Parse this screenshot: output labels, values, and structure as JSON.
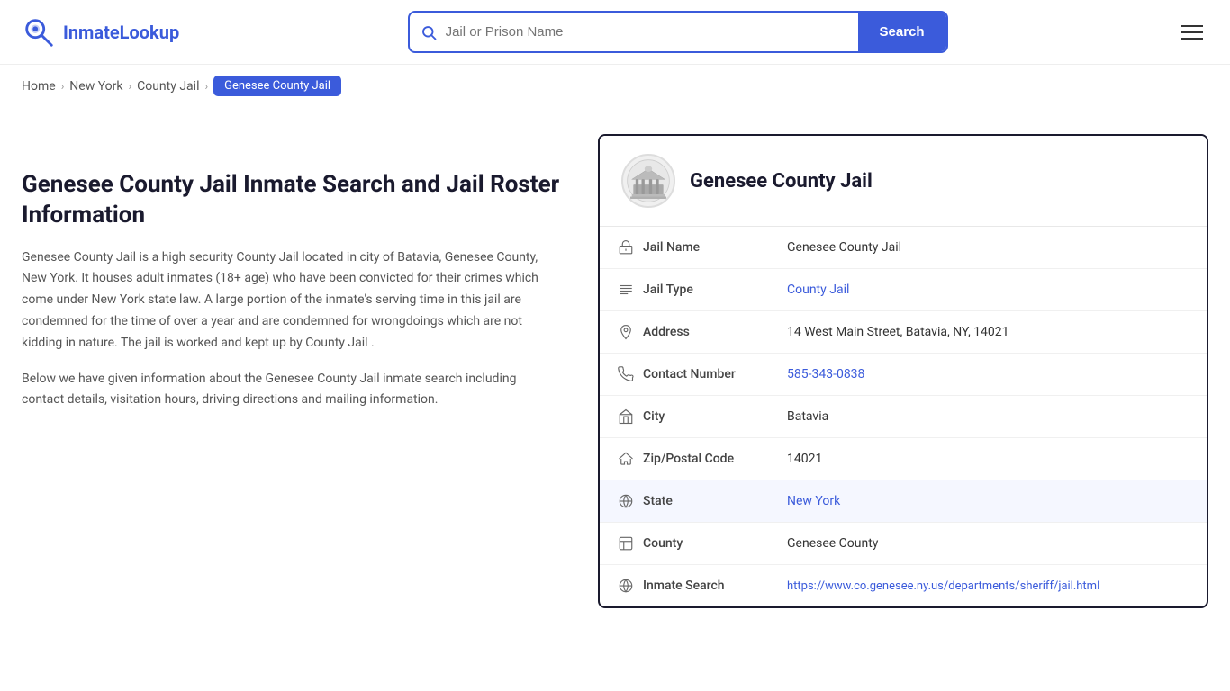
{
  "site": {
    "name": "InmateLookup",
    "name_part1": "Inmate",
    "name_part2": "Lookup"
  },
  "header": {
    "search_placeholder": "Jail or Prison Name",
    "search_button_label": "Search",
    "menu_icon": "hamburger-icon"
  },
  "breadcrumb": {
    "home": "Home",
    "state": "New York",
    "category": "County Jail",
    "current": "Genesee County Jail"
  },
  "page": {
    "heading": "Genesee County Jail Inmate Search and Jail Roster Information",
    "description1": "Genesee County Jail is a high security County Jail located in city of Batavia, Genesee County, New York. It houses adult inmates (18+ age) who have been convicted for their crimes which come under New York state law. A large portion of the inmate's serving time in this jail are condemned for the time of over a year and are condemned for wrongdoings which are not kidding in nature. The jail is worked and kept up by County Jail .",
    "description2": "Below we have given information about the Genesee County Jail inmate search including contact details, visitation hours, driving directions and mailing information."
  },
  "jail": {
    "name": "Genesee County Jail",
    "fields": {
      "jail_name_label": "Jail Name",
      "jail_name_value": "Genesee County Jail",
      "jail_type_label": "Jail Type",
      "jail_type_value": "County Jail",
      "jail_type_link": "#",
      "address_label": "Address",
      "address_value": "14 West Main Street, Batavia, NY, 14021",
      "contact_label": "Contact Number",
      "contact_value": "585-343-0838",
      "contact_link": "tel:585-343-0838",
      "city_label": "City",
      "city_value": "Batavia",
      "zip_label": "Zip/Postal Code",
      "zip_value": "14021",
      "state_label": "State",
      "state_value": "New York",
      "state_link": "#",
      "county_label": "County",
      "county_value": "Genesee County",
      "inmate_search_label": "Inmate Search",
      "inmate_search_value": "https://www.co.genesee.ny.us/departments/sheriff/jail.html",
      "inmate_search_link": "https://www.co.genesee.ny.us/departments/sheriff/jail.html"
    }
  }
}
